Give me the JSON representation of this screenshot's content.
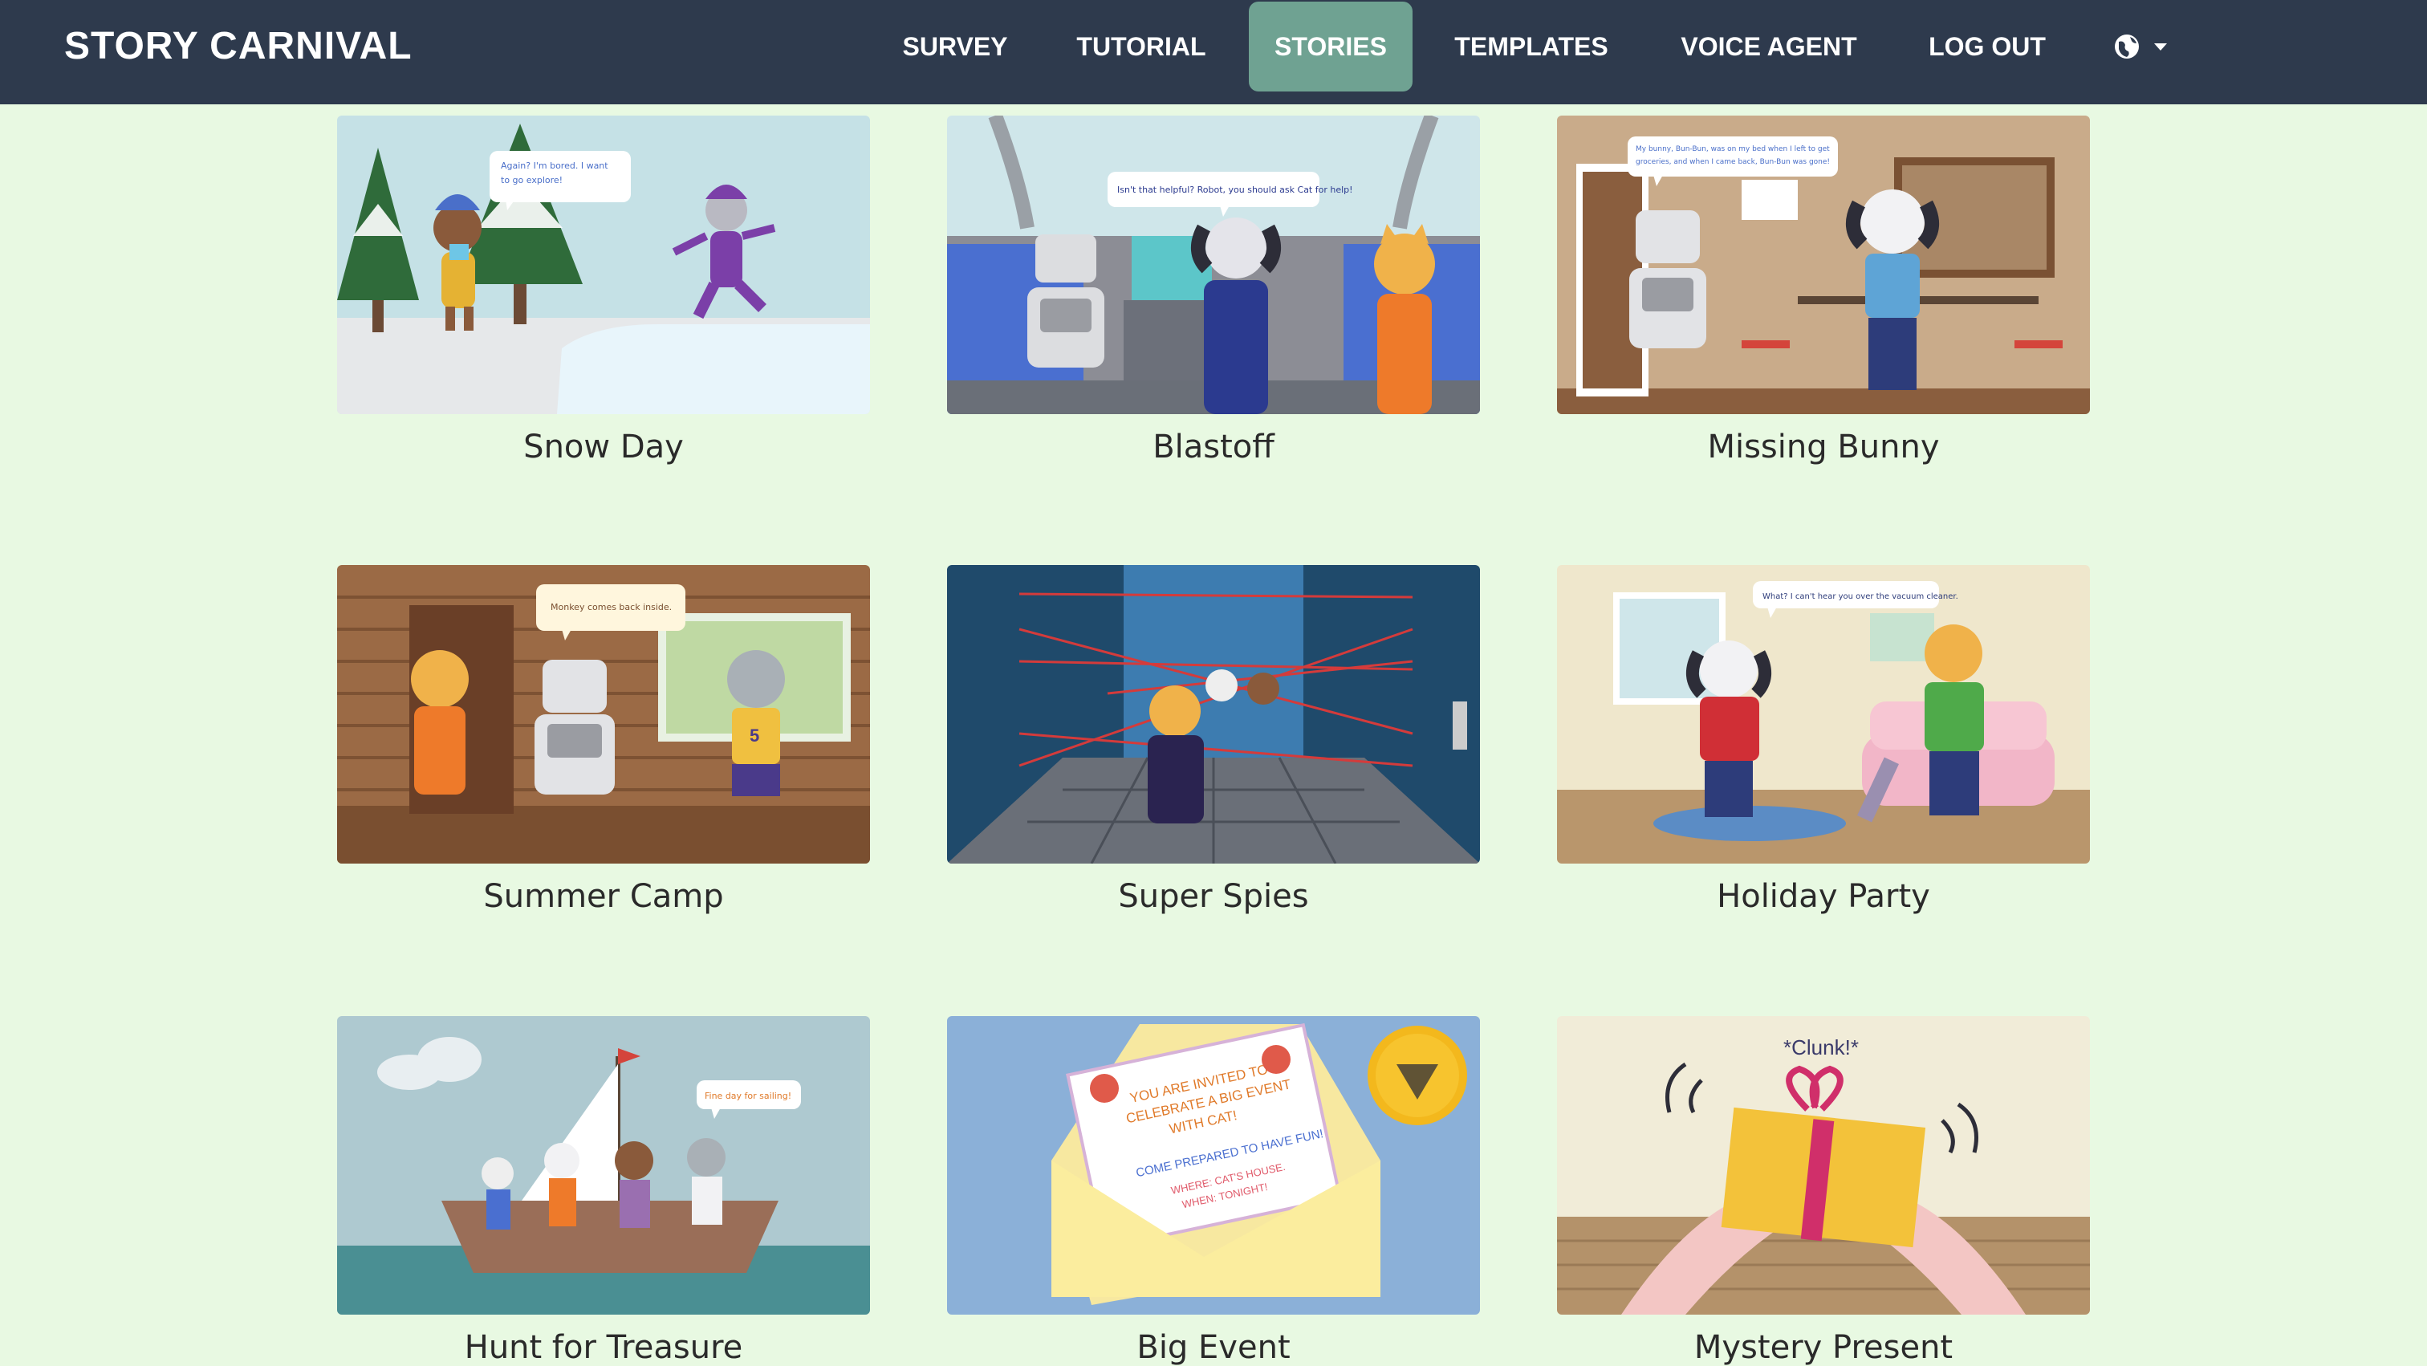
{
  "brand": "STORY CARNIVAL",
  "nav": {
    "items": [
      {
        "label": "SURVEY"
      },
      {
        "label": "TUTORIAL"
      },
      {
        "label": "STORIES"
      },
      {
        "label": "TEMPLATES"
      },
      {
        "label": "VOICE AGENT"
      },
      {
        "label": "LOG OUT"
      }
    ],
    "active": "STORIES",
    "language_icon": "globe-icon",
    "dropdown_icon": "caret-down-icon"
  },
  "stories": [
    {
      "title": "Snow Day",
      "bubble": "Again? I'm bored. I want to go explore!"
    },
    {
      "title": "Blastoff",
      "bubble": "Isn't that helpful? Robot, you should ask Cat for help!"
    },
    {
      "title": "Missing Bunny",
      "bubble": "My bunny, Bun-Bun, was on my bed when I left to get groceries, and when I came back, Bun-Bun was gone!"
    },
    {
      "title": "Summer Camp",
      "bubble": "Monkey comes back inside."
    },
    {
      "title": "Super Spies",
      "bubble": ""
    },
    {
      "title": "Holiday Party",
      "bubble": "What? I can't hear you over the vacuum cleaner."
    },
    {
      "title": "Hunt for Treasure",
      "bubble": "Fine day for sailing!"
    },
    {
      "title": "Big Event",
      "bubble": ""
    },
    {
      "title": "Mystery Present",
      "bubble": "*Clunk!*"
    }
  ],
  "invitation": {
    "line1": "YOU ARE INVITED TO",
    "line2": "CELEBRATE A BIG EVENT",
    "line3": "WITH CAT!",
    "line4": "COME PREPARED TO HAVE FUN!",
    "line5": "WHERE: CAT'S HOUSE.",
    "line6": "WHEN: TONIGHT!"
  },
  "jersey_number": "5",
  "colors": {
    "navbar": "#2e3a4d",
    "active_tab": "#6fa292",
    "page_bg": "#e8f9e2"
  }
}
